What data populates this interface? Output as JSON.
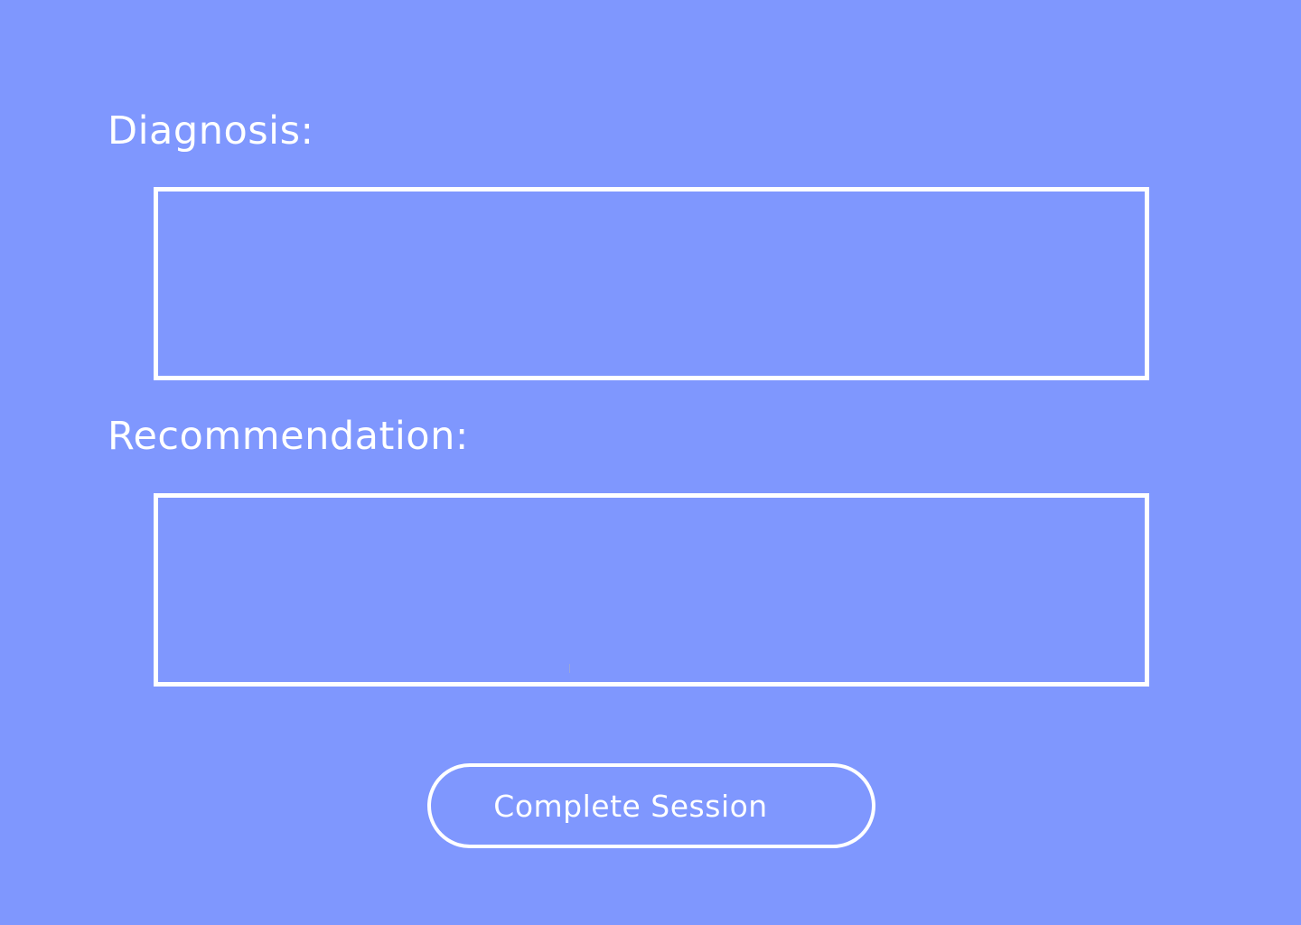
{
  "colors": {
    "background": "#7f97fe",
    "foreground": "#ffffff"
  },
  "diagnosis": {
    "label": "Diagnosis:",
    "value": "",
    "placeholder": ""
  },
  "recommendation": {
    "label": "Recommendation:",
    "value": "",
    "placeholder": ""
  },
  "actions": {
    "complete_label": "Complete Session"
  }
}
